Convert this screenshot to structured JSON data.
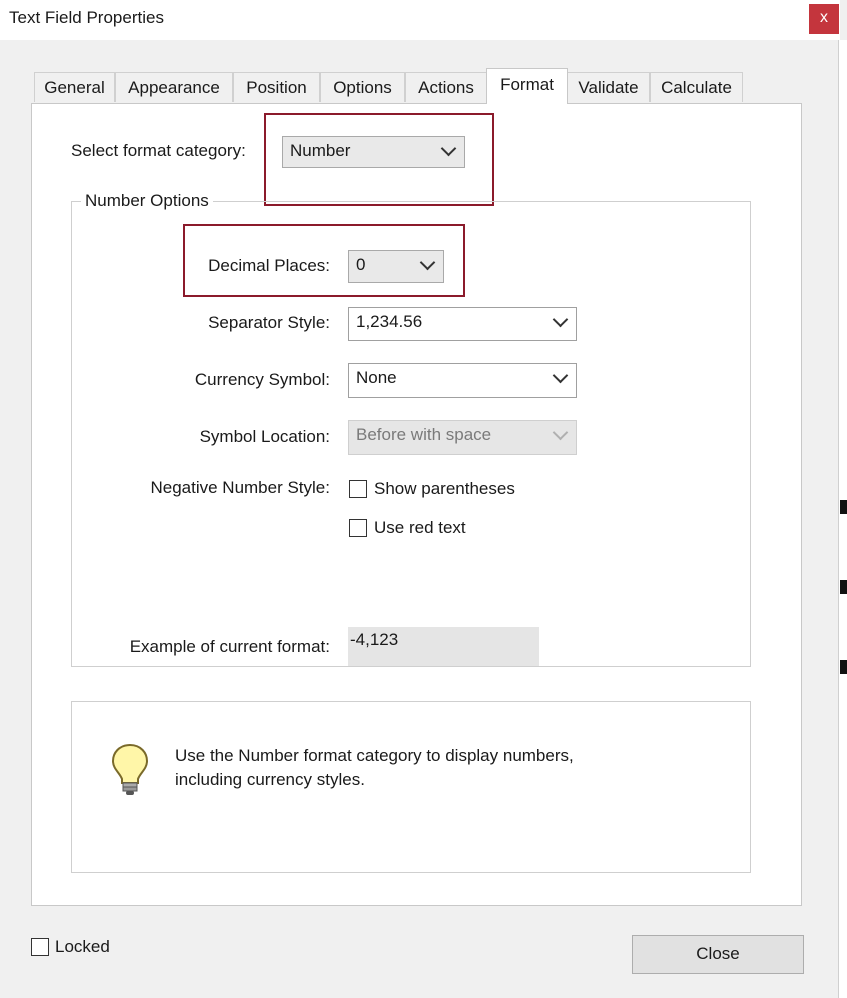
{
  "window": {
    "title": "Text Field Properties",
    "close_glyph": "x"
  },
  "tabs": [
    {
      "label": "General"
    },
    {
      "label": "Appearance"
    },
    {
      "label": "Position"
    },
    {
      "label": "Options"
    },
    {
      "label": "Actions"
    },
    {
      "label": "Format",
      "active": true
    },
    {
      "label": "Validate"
    },
    {
      "label": "Calculate"
    }
  ],
  "format": {
    "category_label": "Select format category:",
    "category_value": "Number",
    "group_title": "Number Options",
    "decimal_label": "Decimal Places:",
    "decimal_value": "0",
    "separator_label": "Separator Style:",
    "separator_value": "1,234.56",
    "currency_label": "Currency Symbol:",
    "currency_value": "None",
    "symbol_location_label": "Symbol Location:",
    "symbol_location_value": "Before with space",
    "negative_label": "Negative Number Style:",
    "show_parentheses_label": "Show parentheses",
    "use_red_label": "Use red text",
    "example_label": "Example of current format:",
    "example_value": "-4,123"
  },
  "tip": {
    "line1": "Use the Number format category to display numbers,",
    "line2": "including currency styles.",
    "icon": "lightbulb-icon"
  },
  "footer": {
    "locked_label": "Locked",
    "close_label": "Close"
  },
  "colors": {
    "highlight": "#8b1a2b",
    "close_x": "#c4353d"
  }
}
